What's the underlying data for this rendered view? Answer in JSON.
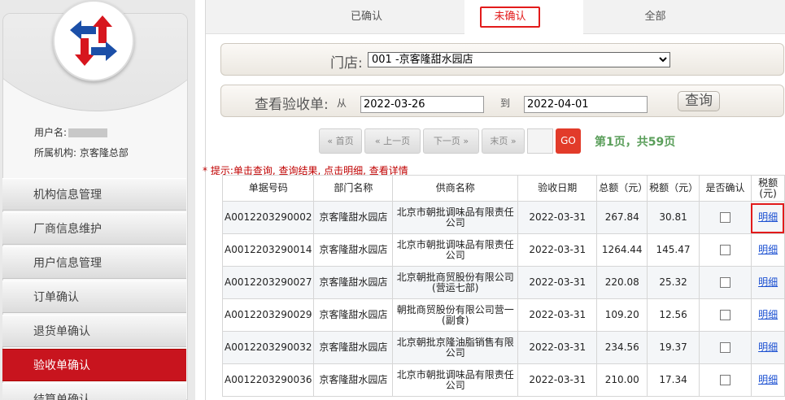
{
  "sidebar": {
    "user_label": "用户名:",
    "org_label": "所属机构:",
    "org_value": "京客隆总部",
    "menu": [
      {
        "label": "机构信息管理"
      },
      {
        "label": "厂商信息维护"
      },
      {
        "label": "用户信息管理"
      },
      {
        "label": "订单确认"
      },
      {
        "label": "退货单确认"
      },
      {
        "label": "验收单确认",
        "active": true
      },
      {
        "label": "结算单确认"
      }
    ]
  },
  "tabs": {
    "confirmed": "已确认",
    "unconfirmed": "未确认",
    "all": "全部"
  },
  "store": {
    "label": "门店:",
    "selected": "001 -京客隆甜水园店"
  },
  "search": {
    "label": "查看验收单:",
    "from_label": "从",
    "from": "2022-03-26",
    "to_label": "到",
    "to": "2022-04-01",
    "query_label": "查询"
  },
  "pager": {
    "first": "首页",
    "prev": "上一页",
    "next": "下一页",
    "last": "末页",
    "go": "GO",
    "info": "第1页，共59页"
  },
  "tip": "* 提示:单击查询, 查询结果, 点击明细, 查看详情",
  "table": {
    "headers": [
      "单据号码",
      "部门名称",
      "供商名称",
      "验收日期",
      "总额（元）",
      "税额（元）",
      "是否确认",
      "税额(元)"
    ],
    "rows": [
      [
        "A0012203290002",
        "京客隆甜水园店",
        "北京市朝批调味品有限责任公司",
        "2022-03-31",
        "267.84",
        "30.81",
        "明细"
      ],
      [
        "A0012203290014",
        "京客隆甜水园店",
        "北京市朝批调味品有限责任公司",
        "2022-03-31",
        "1264.44",
        "145.47",
        "明细"
      ],
      [
        "A0012203290027",
        "京客隆甜水园店",
        "北京朝批商贸股份有限公司(营运七部)",
        "2022-03-31",
        "220.08",
        "25.32",
        "明细"
      ],
      [
        "A0012203290029",
        "京客隆甜水园店",
        "朝批商贸股份有限公司营一(副食)",
        "2022-03-31",
        "109.20",
        "12.56",
        "明细"
      ],
      [
        "A0012203290032",
        "京客隆甜水园店",
        "北京朝批京隆油脂销售有限公司",
        "2022-03-31",
        "234.56",
        "19.37",
        "明细"
      ],
      [
        "A0012203290036",
        "京客隆甜水园店",
        "北京市朝批调味品有限责任公司",
        "2022-03-31",
        "210.00",
        "17.34",
        "明细"
      ]
    ]
  },
  "colors": {
    "accent_red": "#e21b1b",
    "active_menu": "#c8141e",
    "page_info_green": "#5a9e5a",
    "link_blue": "#1a4fd1"
  }
}
